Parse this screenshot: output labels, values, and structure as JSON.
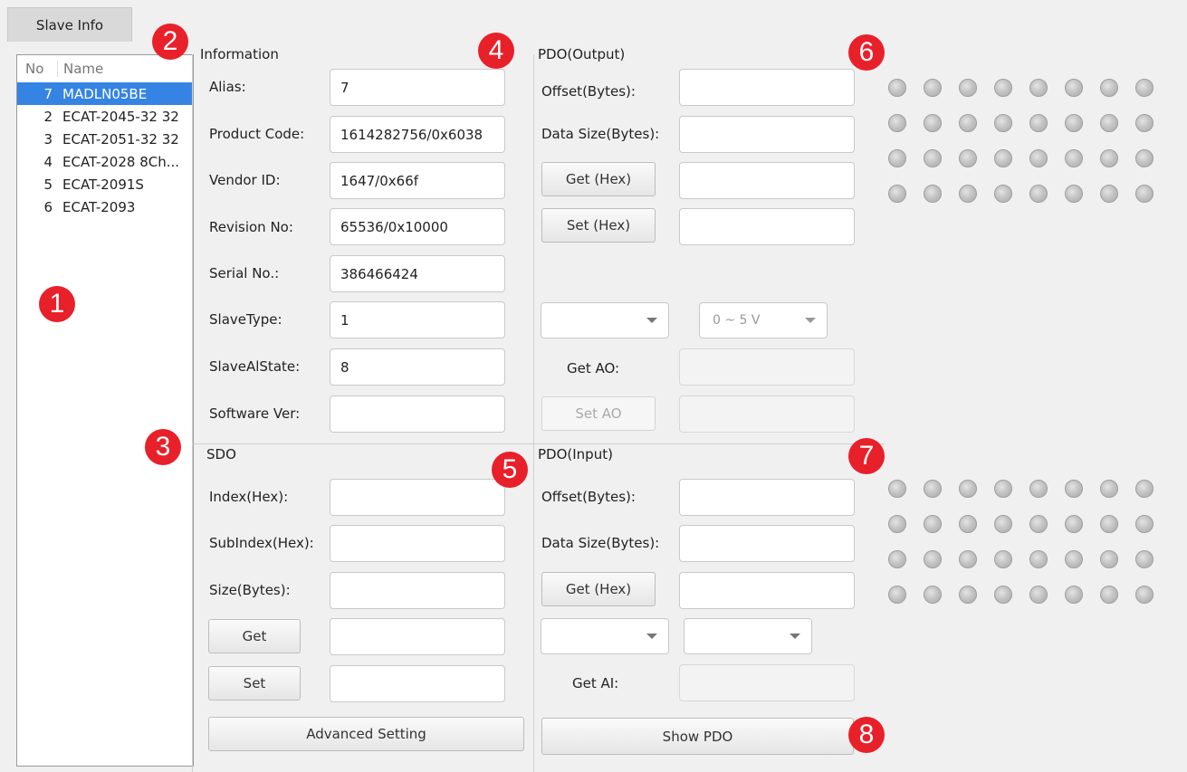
{
  "tab": {
    "label": "Slave Info"
  },
  "slave_list": {
    "headers": {
      "no": "No",
      "name": "Name"
    },
    "rows": [
      {
        "no": "7",
        "name": "MADLN05BE",
        "selected": true
      },
      {
        "no": "2",
        "name": "ECAT-2045-32 32"
      },
      {
        "no": "3",
        "name": "ECAT-2051-32 32"
      },
      {
        "no": "4",
        "name": "ECAT-2028 8Ch..."
      },
      {
        "no": "5",
        "name": "ECAT-2091S"
      },
      {
        "no": "6",
        "name": "ECAT-2093"
      }
    ]
  },
  "information": {
    "title": "Information",
    "fields": [
      {
        "label": "Alias:",
        "value": "7"
      },
      {
        "label": "Product Code:",
        "value": "1614282756/0x6038"
      },
      {
        "label": "Vendor ID:",
        "value": "1647/0x66f"
      },
      {
        "label": "Revision No:",
        "value": "65536/0x10000"
      },
      {
        "label": "Serial No.:",
        "value": "386466424"
      },
      {
        "label": "SlaveType:",
        "value": "1"
      },
      {
        "label": "SlaveAlState:",
        "value": "8"
      },
      {
        "label": "Software Ver:",
        "value": ""
      }
    ]
  },
  "sdo": {
    "title": "SDO",
    "index_label": "Index(Hex):",
    "subindex_label": "SubIndex(Hex):",
    "size_label": "Size(Bytes):",
    "get_button": "Get",
    "set_button": "Set",
    "advanced_button": "Advanced Setting"
  },
  "pdo_output": {
    "title": "PDO(Output)",
    "offset_label": "Offset(Bytes):",
    "datasize_label": "Data Size(Bytes):",
    "get_hex_button": "Get (Hex)",
    "set_hex_button": "Set (Hex)",
    "range_select": "0 ~ 5 V",
    "get_ao_label": "Get AO:",
    "set_ao_button": "Set AO"
  },
  "pdo_input": {
    "title": "PDO(Input)",
    "offset_label": "Offset(Bytes):",
    "datasize_label": "Data Size(Bytes):",
    "get_hex_button": "Get (Hex)",
    "get_ai_label": "Get AI:",
    "show_pdo_button": "Show PDO"
  },
  "led_output": {
    "count": 32,
    "state": "off"
  },
  "led_input": {
    "count": 32,
    "state": "off"
  },
  "badges": [
    "1",
    "2",
    "3",
    "4",
    "5",
    "6",
    "7",
    "8"
  ],
  "colors": {
    "badge": "#e8202a",
    "selection": "#3584e4"
  }
}
